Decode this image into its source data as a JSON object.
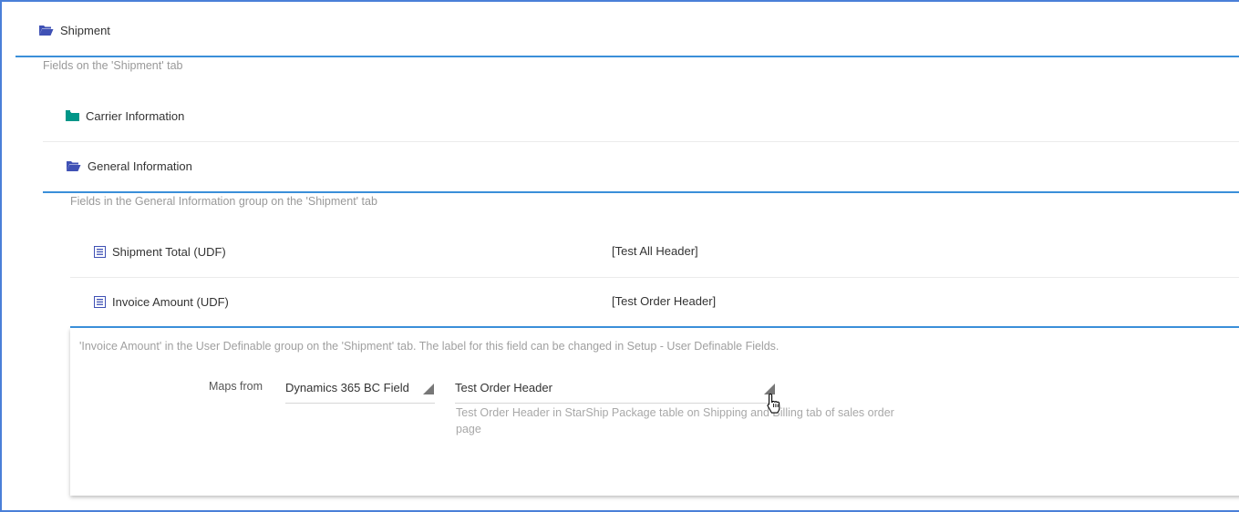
{
  "shipment": {
    "label": "Shipment",
    "description": "Fields on the 'Shipment' tab"
  },
  "groups": {
    "carrier": {
      "label": "Carrier Information"
    },
    "general": {
      "label": "General Information",
      "description": "Fields in the General Information group on the 'Shipment' tab"
    }
  },
  "fields": [
    {
      "label": "Shipment Total (UDF)",
      "value": "[Test All Header]"
    },
    {
      "label": "Invoice Amount (UDF)",
      "value": "[Test Order Header]"
    }
  ],
  "detail": {
    "description": "'Invoice Amount' in the User Definable group on the 'Shipment' tab. The label for this field can be changed in Setup - User Definable Fields.",
    "maps_from_label": "Maps from",
    "source_type": "Dynamics 365 BC Field",
    "source_field": "Test Order Header",
    "source_help_line1": "Test Order Header in StarShip Package table on Shipping and Billing tab of sales order",
    "source_help_line2": "page"
  },
  "colors": {
    "open_folder": "#3f51b5",
    "closed_folder": "#009688",
    "accent_line": "#3a8fd9"
  },
  "icons": {
    "open_folder": "folder-open-icon",
    "closed_folder": "folder-icon",
    "field": "list-icon"
  }
}
